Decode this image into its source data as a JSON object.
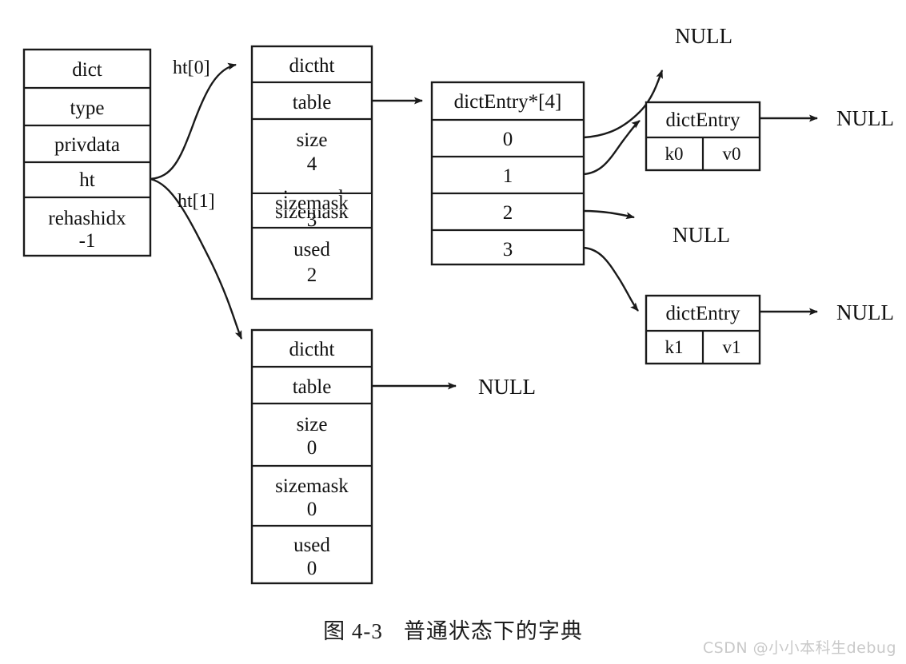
{
  "figure": {
    "caption_number": "图 4-3",
    "caption_title": "普通状态下的字典",
    "watermark": "CSDN @小小本科生debug"
  },
  "dict_struct": {
    "title": "dict",
    "fields": [
      {
        "name": "type",
        "value": ""
      },
      {
        "name": "privdata",
        "value": ""
      },
      {
        "name": "ht",
        "value": ""
      },
      {
        "name": "rehashidx",
        "value": "-1"
      }
    ]
  },
  "pointer_labels": {
    "ht0": "ht[0]",
    "ht1": "ht[1]"
  },
  "ht0": {
    "title": "dictht",
    "fields": [
      {
        "name": "table",
        "value": ""
      },
      {
        "name": "size",
        "value": "4"
      },
      {
        "name": "sizemask",
        "value": "3"
      },
      {
        "name": "used",
        "value": "2"
      }
    ]
  },
  "ht1": {
    "title": "dictht",
    "fields": [
      {
        "name": "table",
        "value": ""
      },
      {
        "name": "size",
        "value": "0"
      },
      {
        "name": "sizemask",
        "value": "0"
      },
      {
        "name": "used",
        "value": "0"
      }
    ],
    "table_target": "NULL"
  },
  "bucket_array": {
    "title": "dictEntry*[4]",
    "slots": [
      "0",
      "1",
      "2",
      "3"
    ]
  },
  "entries": [
    {
      "title": "dictEntry",
      "key": "k0",
      "value": "v0",
      "next": "NULL"
    },
    {
      "title": "dictEntry",
      "key": "k1",
      "value": "v1",
      "next": "NULL"
    }
  ],
  "null_labels": {
    "slot0": "NULL",
    "slot2": "NULL"
  }
}
